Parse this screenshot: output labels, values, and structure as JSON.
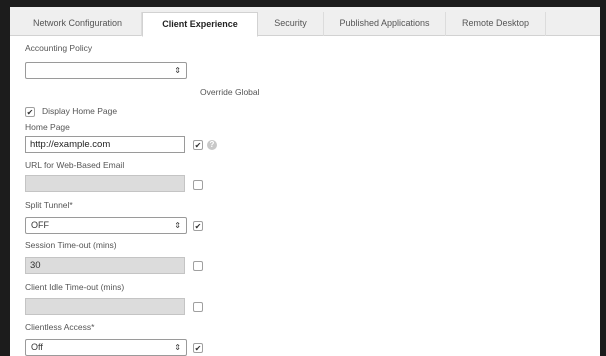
{
  "tabs": [
    {
      "label": "Network Configuration"
    },
    {
      "label": "Client Experience"
    },
    {
      "label": "Security"
    },
    {
      "label": "Published Applications"
    },
    {
      "label": "Remote Desktop"
    }
  ],
  "accounting_policy": {
    "label": "Accounting Policy",
    "value": ""
  },
  "override_global_label": "Override Global",
  "display_home_page": {
    "label": "Display Home Page",
    "checked": true
  },
  "home_page": {
    "label": "Home Page",
    "value": "http://example.com",
    "override": true
  },
  "web_email": {
    "label": "URL for Web-Based Email",
    "value": "",
    "override": false
  },
  "split_tunnel": {
    "label": "Split Tunnel*",
    "value": "OFF",
    "override": true
  },
  "session_timeout": {
    "label": "Session Time-out (mins)",
    "value": "30",
    "override": false
  },
  "idle_timeout": {
    "label": "Client Idle Time-out (mins)",
    "value": "",
    "override": false
  },
  "clientless_access": {
    "label": "Clientless Access*",
    "value": "Off",
    "override": true
  },
  "icons": {
    "dropdown": "updown-arrow-icon",
    "help": "help-icon",
    "check": "checkmark-icon"
  }
}
